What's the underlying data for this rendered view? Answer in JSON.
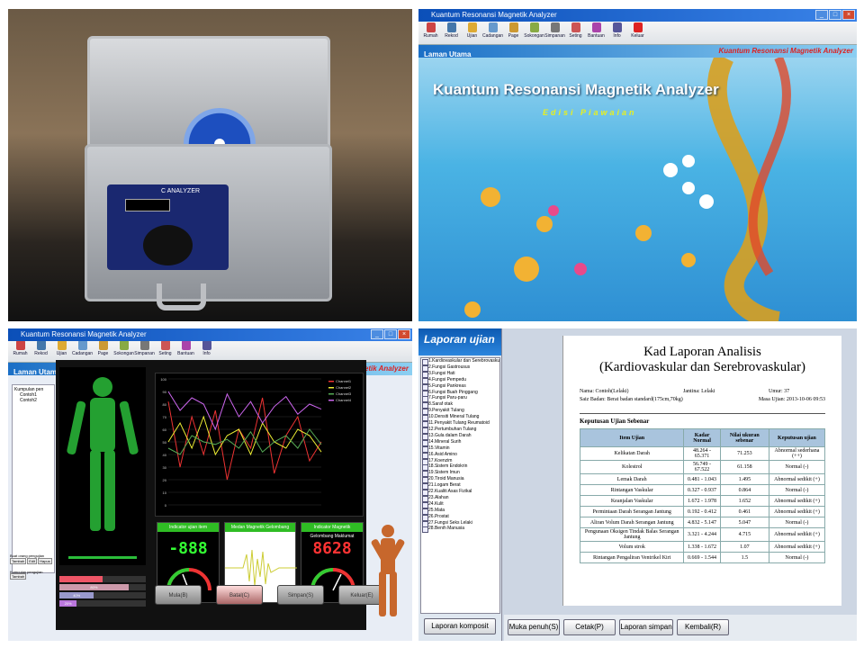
{
  "splash": {
    "window_title": "Kuantum Resonansi Magnetik Analyzer",
    "nav_left": "Laman Utama",
    "nav_right": "Kuantum Resonansi Magnetik Analyzer",
    "main_title": "Kuantum Resonansi Magnetik Analyzer",
    "edition": "Edisi Piawaian",
    "toolbar": [
      {
        "label": "Rumah",
        "color": "#c44"
      },
      {
        "label": "Rekod",
        "color": "#47a"
      },
      {
        "label": "Ujian",
        "color": "#da3"
      },
      {
        "label": "Cadangan",
        "color": "#69c"
      },
      {
        "label": "Page",
        "color": "#c93"
      },
      {
        "label": "Sokongan",
        "color": "#8a4"
      },
      {
        "label": "Simpanan",
        "color": "#777"
      },
      {
        "label": "Seting",
        "color": "#c55"
      },
      {
        "label": "Bantuan",
        "color": "#a4a"
      },
      {
        "label": "Info",
        "color": "#559"
      },
      {
        "label": "Keluar",
        "color": "#d22"
      }
    ]
  },
  "photo": {
    "device_label": "C ANALYZER"
  },
  "analysis": {
    "window_title": "Kuantum Resonansi Magnetik Analyzer",
    "nav_left": "Laman Utama",
    "nav_right": "Magnetik Analyzer",
    "tree_root": "Kumpulan pen",
    "tree_items": [
      "Contoh1",
      "Contoh2"
    ],
    "left_group_label": "Buat orang pengujian",
    "left_buttons": [
      "Tambah",
      "Edit",
      "Hapus"
    ],
    "left_group_label2": "Kumpulan pengujian",
    "left_buttons2": [
      "Tambah"
    ],
    "box1_title": "Indicator ujian item",
    "box1_value": "-888",
    "box2_title": "Medan Magnetik Gelombang Maklumat semasa",
    "box3_title": "Indicator Magnetik Gelombang Maklumat",
    "box3_value": "8628",
    "legend": [
      "Channel1",
      "Channel2",
      "Channel3",
      "Channel4"
    ],
    "buttons": [
      "Mula(B)",
      "Batal(C)",
      "Simpan(S)",
      "Keluar(E)"
    ],
    "progress": [
      {
        "label": "",
        "value": 0.5,
        "color": "#e56"
      },
      {
        "label": "80%",
        "value": 0.8,
        "color": "#c9a"
      },
      {
        "label": "40%",
        "value": 0.4,
        "color": "#99c"
      },
      {
        "label": "20%",
        "value": 0.2,
        "color": "#b7d"
      }
    ],
    "chart_data": {
      "type": "line",
      "yticks": [
        "100",
        "90",
        "80",
        "70",
        "60",
        "50",
        "40",
        "30",
        "20",
        "10",
        "0"
      ],
      "ylim": [
        0,
        100
      ],
      "series": [
        {
          "name": "Channel1",
          "color": "#e33",
          "values": [
            82,
            30,
            70,
            40,
            75,
            20,
            60,
            45,
            85,
            25,
            55,
            70,
            35,
            50
          ]
        },
        {
          "name": "Channel2",
          "color": "#ee3",
          "values": [
            50,
            65,
            45,
            70,
            40,
            55,
            60,
            40,
            65,
            50,
            45,
            60,
            55,
            42
          ]
        },
        {
          "name": "Channel3",
          "color": "#5a5",
          "values": [
            45,
            40,
            55,
            50,
            48,
            52,
            45,
            58,
            42,
            50,
            55,
            45,
            60,
            48
          ]
        },
        {
          "name": "Channel4",
          "color": "#c6e",
          "values": [
            90,
            75,
            85,
            80,
            60,
            88,
            70,
            82,
            65,
            78,
            86,
            72,
            80,
            76
          ]
        }
      ]
    }
  },
  "report": {
    "sidebar_title": "Laporan ujian",
    "list": [
      "1.Kardiovaskular dan Serebrovaskular",
      "2.Fungsi Gastrousus",
      "3.Fungsi Hati",
      "4.Fungsi Pempedu",
      "5.Fungsi Pankreas",
      "6.Fungsi Buah Pinggang",
      "7.Fungsi Paru-paru",
      "8.Saraf otak",
      "9.Penyakit Tulang",
      "10.Densiti Mineral Tulang",
      "11.Penyakit Tulang Reumatoid",
      "12.Pertumbuhan Tulang",
      "13.Gula dalam Darah",
      "14.Mineral Surih",
      "15.Vitamin",
      "16.Asid Amino",
      "17.Koenzim",
      "18.Sistem Endokrin",
      "19.Sistem Imun",
      "20.Tiroid Manusia",
      "21.Logam Berat",
      "22.Kualiti Asas Fizikal",
      "23.Alahan",
      "24.Kulit",
      "25.Mata",
      "26.Prostat",
      "27.Fungsi Seks Lelaki",
      "28.Benih Manusia"
    ],
    "composite_btn": "Laporan komposit",
    "title1": "Kad Laporan Analisis",
    "title2": "(Kardiovaskular dan Serebrovaskular)",
    "name": "Nama: Contoh(Lelaki)",
    "gender": "Jantina: Lelaki",
    "age": "Umur: 37",
    "body": "Saiz Badan: Berat badan standard(175cm,70kg)",
    "date": "Masa Ujian: 2013-10-06 09:53",
    "section": "Keputusan Ujian Sebenar",
    "columns": [
      "Item Ujian",
      "Kadar Normal",
      "Nilai ukuran sebenar",
      "Keputusan ujian"
    ],
    "rows": [
      [
        "Kelikatan Darah",
        "48.264 - 65.371",
        "71.253",
        "Abnormal sederhana (++)"
      ],
      [
        "Kolestrol",
        "56.749 - 67.522",
        "61.158",
        "Normal (-)"
      ],
      [
        "Lemak Darah",
        "0.481 - 1.043",
        "1.495",
        "Abnormal sedikit (+)"
      ],
      [
        "Rintangan Vaskular",
        "0.327 - 0.937",
        "0.864",
        "Normal (-)"
      ],
      [
        "Keanjalan Vaskular",
        "1.672 - 1.978",
        "1.652",
        "Abnormal sedikit (+)"
      ],
      [
        "Permintaan Darah Serangan Jantung",
        "0.192 - 0.412",
        "0.461",
        "Abnormal sedikit (+)"
      ],
      [
        "Aliran Volum Darah Serangan Jantung",
        "4.832 - 5.147",
        "5.047",
        "Normal (-)"
      ],
      [
        "Pengunaan Oksigen Tindak Balas Serangan Jantung",
        "3.321 - 4.244",
        "4.715",
        "Abnormal sedikit (+)"
      ],
      [
        "Volum strok",
        "1.338 - 1.672",
        "1.07",
        "Abnormal sedikit (+)"
      ],
      [
        "Rintangan Pengaliran Ventrikel Kiri",
        "0.669 - 1.544",
        "1.5",
        "Normal (-)"
      ]
    ],
    "buttons": [
      "Muka penuh(S)",
      "Cetak(P)",
      "Laporan simpan",
      "Kembali(R)"
    ]
  }
}
